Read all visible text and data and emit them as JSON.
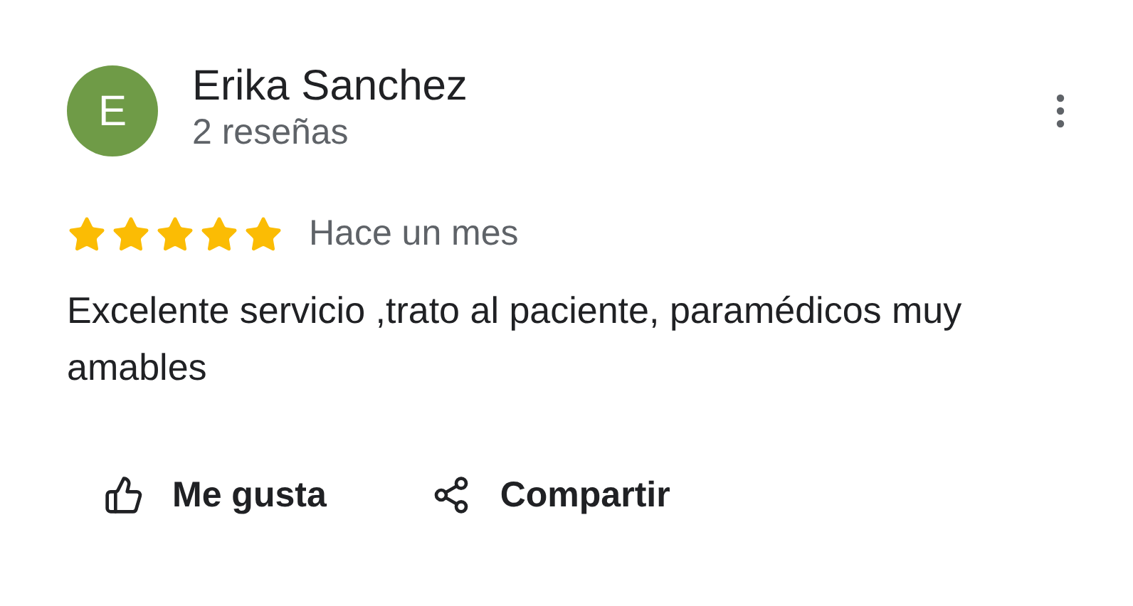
{
  "review": {
    "avatar_letter": "E",
    "author": "Erika Sanchez",
    "review_count": "2 reseñas",
    "stars": 5,
    "time": "Hace un mes",
    "text": "Excelente servicio ,trato al paciente, paramédicos muy amables"
  },
  "actions": [
    {
      "kind": "like",
      "label": "Me gusta"
    },
    {
      "kind": "share",
      "label": "Compartir"
    }
  ]
}
